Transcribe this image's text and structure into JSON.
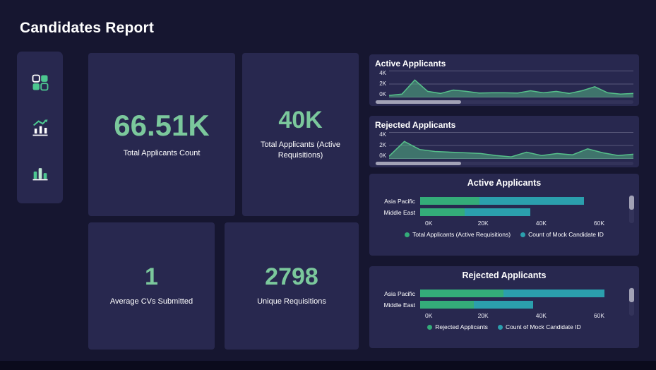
{
  "report": {
    "title": "Candidates Report"
  },
  "colors": {
    "background": "#161630",
    "card": "#28284f",
    "accent_green": "#7bc89c",
    "series_green": "#34ac79",
    "series_teal": "#2b9fad",
    "scroll_thumb": "#a2a2b6",
    "scroll_track": "#33335a"
  },
  "sidebar": {
    "items": [
      {
        "icon": "grid-tiles-icon"
      },
      {
        "icon": "trend-line-icon"
      },
      {
        "icon": "column-chart-icon"
      }
    ]
  },
  "kpis": [
    {
      "value": "66.51K",
      "label": "Total Applicants Count"
    },
    {
      "value": "40K",
      "label": "Total Applicants (Active Requisitions)"
    },
    {
      "value": "1",
      "label": "Average CVs Submitted"
    },
    {
      "value": "2798",
      "label": "Unique Requisitions"
    }
  ],
  "chart_data": [
    {
      "type": "area",
      "title": "Active Applicants",
      "yticks": [
        "4K",
        "2K",
        "0K"
      ],
      "ylim": [
        0,
        4000
      ],
      "grid": true,
      "line_color": "#56c08a",
      "fill_color": "rgba(86,192,138,0.5)",
      "values": [
        300,
        500,
        2600,
        900,
        600,
        1100,
        900,
        650,
        700,
        700,
        650,
        1000,
        700,
        900,
        600,
        1000,
        1600,
        700,
        500,
        600
      ]
    },
    {
      "type": "area",
      "title": "Rejected Applicants",
      "yticks": [
        "4K",
        "2K",
        "0K"
      ],
      "ylim": [
        0,
        4000
      ],
      "grid": true,
      "line_color": "#56c08a",
      "fill_color": "rgba(86,192,138,0.5)",
      "values": [
        400,
        2600,
        1400,
        1100,
        1000,
        900,
        800,
        500,
        300,
        1000,
        500,
        800,
        600,
        1500,
        900,
        500,
        700
      ]
    },
    {
      "type": "bar",
      "title": "Active Applicants",
      "categories": [
        "Asia Pacific",
        "Middle East"
      ],
      "xticks": [
        "0K",
        "20K",
        "40K",
        "60K"
      ],
      "xtick_values": [
        0,
        20000,
        40000,
        60000
      ],
      "xlim": [
        0,
        65000
      ],
      "legend_position": "bottom",
      "series": [
        {
          "name": "Total Applicants (Active Requisitions)",
          "color": "#34ac79",
          "values": [
            20000,
            15000
          ]
        },
        {
          "name": "Count of Mock Candidate ID",
          "color": "#2b9fad",
          "values": [
            35000,
            22000
          ]
        }
      ]
    },
    {
      "type": "bar",
      "title": "Rejected Applicants",
      "categories": [
        "Asia Pacific",
        "Middle East"
      ],
      "xticks": [
        "0K",
        "20K",
        "40K",
        "60K"
      ],
      "xtick_values": [
        0,
        20000,
        40000,
        60000
      ],
      "xlim": [
        0,
        65000
      ],
      "legend_position": "bottom",
      "series": [
        {
          "name": "Rejected Applicants",
          "color": "#34ac79",
          "values": [
            28000,
            18000
          ]
        },
        {
          "name": "Count of Mock Candidate ID",
          "color": "#2b9fad",
          "values": [
            34000,
            20000
          ]
        }
      ]
    }
  ]
}
